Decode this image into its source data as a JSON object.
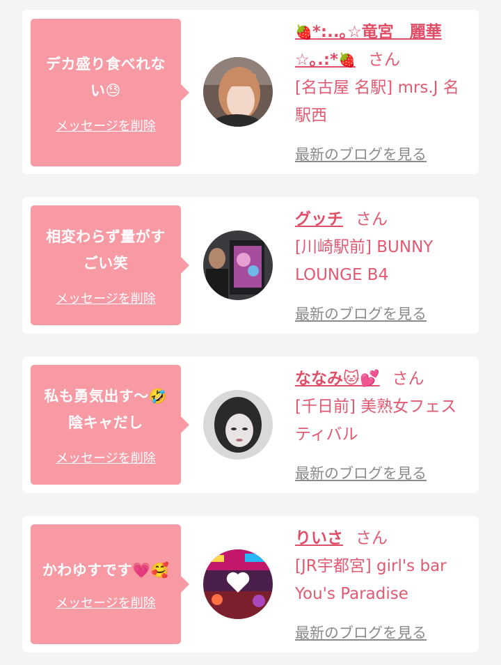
{
  "colors": {
    "bubble": "#f89aa4",
    "name": "#e04d67",
    "text_pink": "#e05a72",
    "link_gray": "#8a8a8a",
    "page_bg": "#f4f4f4"
  },
  "common": {
    "delete_label": "メッセージを削除",
    "blog_label": "最新のブログを見る",
    "san": "さん"
  },
  "cards": [
    {
      "message_line1": "デカ盛り食べれな",
      "message_line2": "い😓",
      "name_prefix_icon": "🍓",
      "name_part1": "*:..｡☆竜宮　麗華",
      "name_part2": "☆｡.:*",
      "name_suffix_icon": "🍓",
      "shop_line1": "[名古屋 名駅] mrs.J 名",
      "shop_line2": "駅西",
      "avatar_icon": "woman-portrait"
    },
    {
      "message_line1": "相変わらず量がす",
      "message_line2": "ごい笑",
      "name": "グッチ",
      "shop_line1": "[川崎駅前] BUNNY",
      "shop_line2": "LOUNGE B4",
      "avatar_icon": "man-with-screen"
    },
    {
      "message_line1": "私も勇気出す〜🤣",
      "message_line2": "陰キャだし",
      "name": "ななみ🐱💕",
      "shop_line1": "[千日前] 美熟女フェス",
      "shop_line2": "ティバル",
      "avatar_icon": "woman-mono-portrait"
    },
    {
      "message_line1": "かわゆすです💗🥰",
      "name": "りいさ",
      "shop_line1": "[JR宇都宮] girl's bar",
      "shop_line2": "You's Paradise",
      "avatar_icon": "colorful-photo-heart"
    }
  ]
}
